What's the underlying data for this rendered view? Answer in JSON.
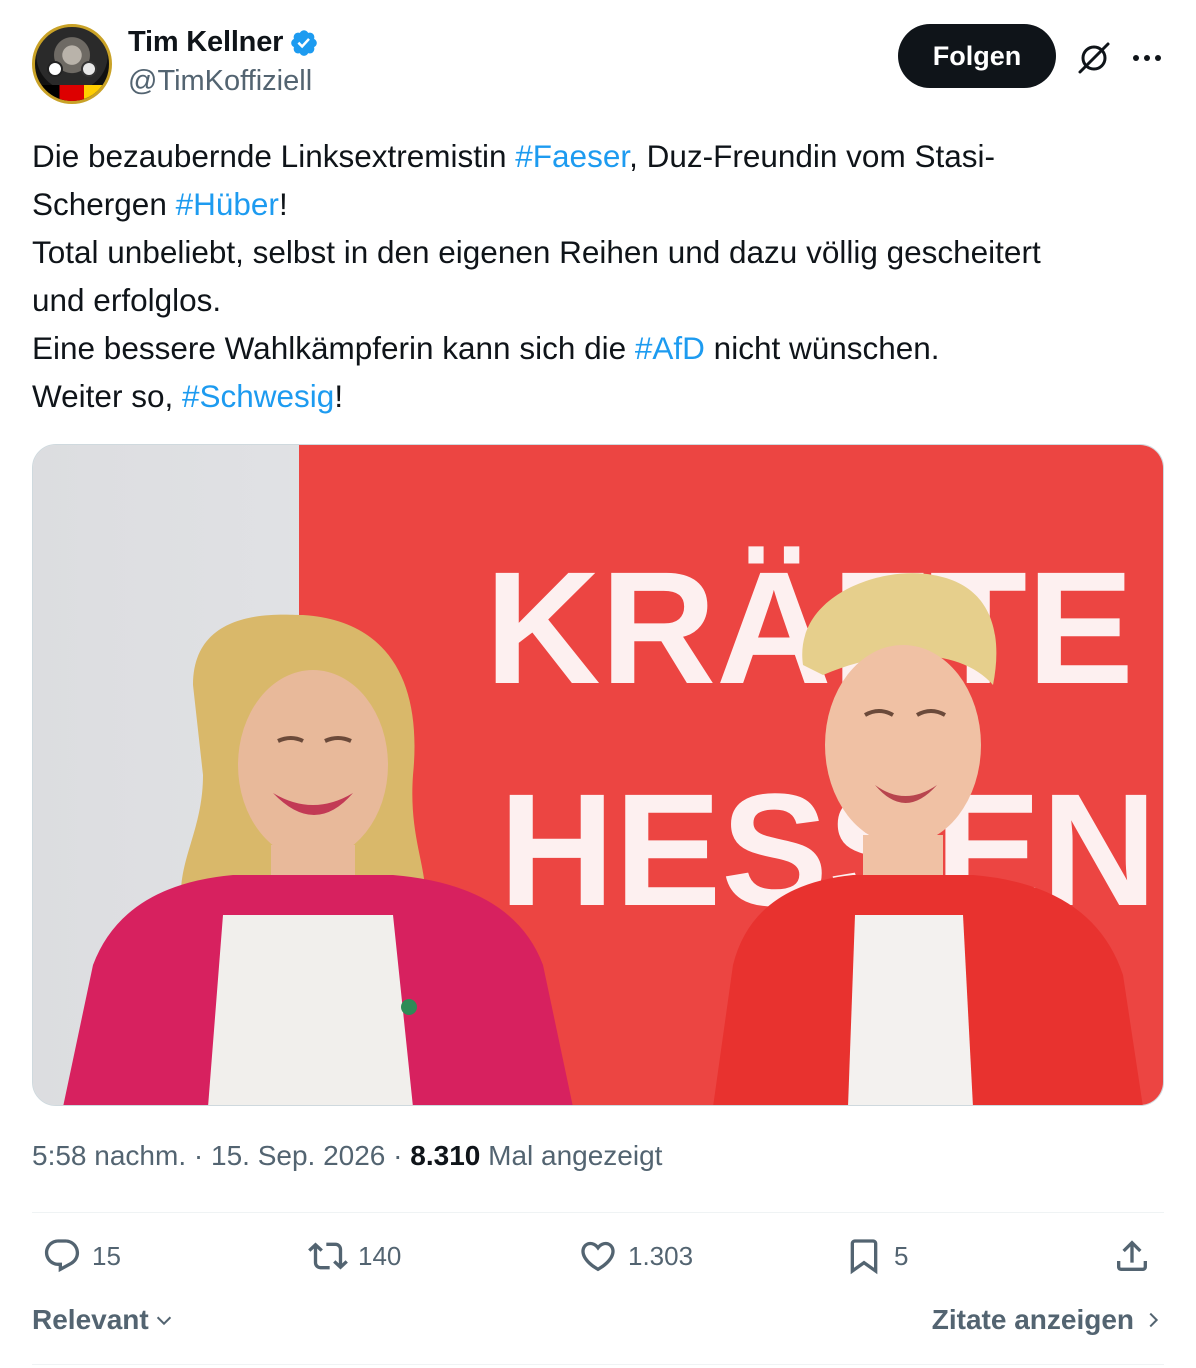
{
  "author": {
    "display_name": "Tim Kellner",
    "handle": "@TimKoffiziell",
    "verified": true,
    "avatar_icon": "avatar-photo"
  },
  "header": {
    "follow_label": "Folgen",
    "grok_icon": "grok-icon",
    "more_icon": "more-icon"
  },
  "tweet": {
    "lines": [
      [
        {
          "text": "Die bezaubernde Linksextremistin "
        },
        {
          "text": "#Faeser",
          "tag": true
        },
        {
          "text": ", Duz-Freundin vom Stasi-"
        }
      ],
      [
        {
          "text": "Schergen "
        },
        {
          "text": "#Hüber",
          "tag": true
        },
        {
          "text": "!"
        }
      ],
      [
        {
          "text": "Total unbeliebt, selbst in den eigenen Reihen und dazu völlig gescheitert"
        }
      ],
      [
        {
          "text": "und erfolglos."
        }
      ],
      [
        {
          "text": "Eine bessere Wahlkämpferin kann sich die "
        },
        {
          "text": "#AfD",
          "tag": true
        },
        {
          "text": " nicht wünschen."
        }
      ],
      [
        {
          "text": "Weiter so, "
        },
        {
          "text": "#Schwesig",
          "tag": true
        },
        {
          "text": "!"
        }
      ]
    ]
  },
  "media": {
    "banner_words": [
      "KRÄFTE",
      "HESSEN."
    ]
  },
  "meta": {
    "time": "5:58 nachm.",
    "separator": " · ",
    "date": "15. Sep. 2026",
    "views": "8.310",
    "views_label": "Mal angezeigt"
  },
  "actions": {
    "replies": "15",
    "reposts": "140",
    "likes": "1.303",
    "bookmarks": "5"
  },
  "footer": {
    "sort_label": "Relevant",
    "quotes_label": "Zitate anzeigen"
  },
  "colors": {
    "link": "#1d9bf0",
    "secondary_text": "#536471",
    "primary_text": "#0f1419",
    "verified": "#1d9bf0",
    "banner_red": "#e8413f"
  }
}
